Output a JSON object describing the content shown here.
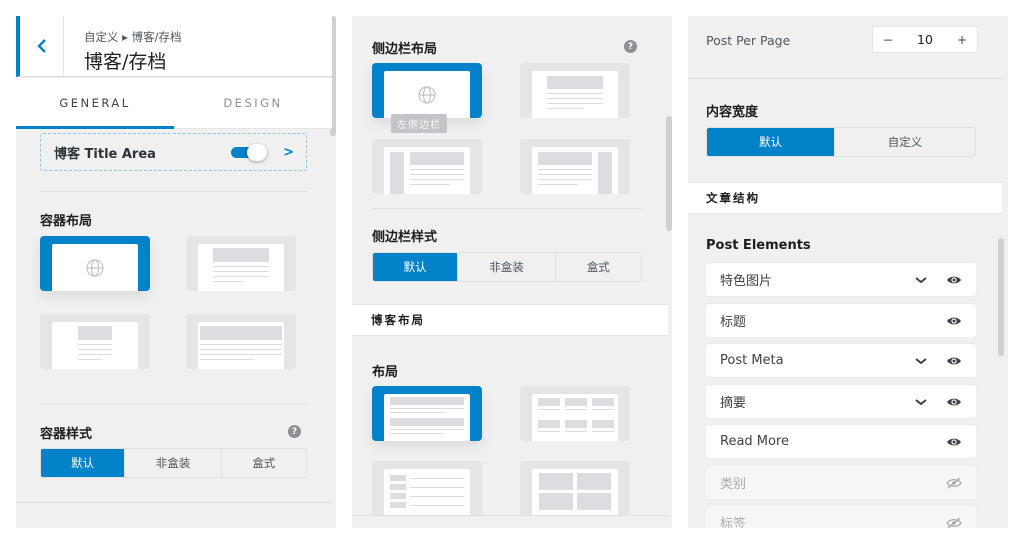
{
  "panel1": {
    "breadcrumb": "自定义 ▸ 博客/存档",
    "title": "博客/存档",
    "tabs": [
      {
        "label": "GENERAL",
        "active": true
      },
      {
        "label": "DESIGN",
        "active": false
      }
    ],
    "title_area": {
      "label": "博客 Title Area",
      "toggle_on": true
    },
    "container_layout": {
      "title": "容器布局",
      "options": [
        "full-width",
        "boxed",
        "narrow",
        "wide"
      ],
      "selected": 0
    },
    "container_style": {
      "title": "容器样式",
      "help_icon": "?",
      "options": [
        "默认",
        "非盒装",
        "盒式"
      ],
      "selected": 0
    }
  },
  "panel2": {
    "sidebar_layout": {
      "title": "侧边栏布局",
      "help_icon": "?",
      "tooltip": "左侧边栏",
      "options": [
        "default",
        "no-sidebar",
        "left-sidebar",
        "right-sidebar"
      ],
      "selected": 0
    },
    "sidebar_style": {
      "title": "侧边栏样式",
      "options": [
        "默认",
        "非盒装",
        "盒式"
      ],
      "selected": 0
    },
    "blog_layout_band": "博客布局",
    "layout": {
      "title": "布局",
      "options": [
        "list",
        "grid",
        "thumbnail-list",
        "cards"
      ],
      "selected": 0
    }
  },
  "panel3": {
    "post_per_page": {
      "label": "Post Per Page",
      "value": "10",
      "minus": "−",
      "plus": "+"
    },
    "content_width": {
      "title": "内容宽度",
      "options": [
        "默认",
        "自定义"
      ],
      "selected": 0
    },
    "post_structure_band": "文章结构",
    "post_elements": {
      "title": "Post Elements",
      "items": [
        {
          "label": "特色图片",
          "has_dropdown": true,
          "visible": true
        },
        {
          "label": "标题",
          "has_dropdown": false,
          "visible": true
        },
        {
          "label": "Post Meta",
          "has_dropdown": true,
          "visible": true
        },
        {
          "label": "摘要",
          "has_dropdown": true,
          "visible": true
        },
        {
          "label": "Read More",
          "has_dropdown": false,
          "visible": true
        },
        {
          "label": "类别",
          "has_dropdown": false,
          "visible": false
        },
        {
          "label": "标签",
          "has_dropdown": false,
          "visible": false
        }
      ]
    }
  },
  "colors": {
    "accent": "#0282c8",
    "panel_bg": "#f0f0f1",
    "option_bg": "#e4e5e7",
    "placeholder": "#dcdde0"
  }
}
